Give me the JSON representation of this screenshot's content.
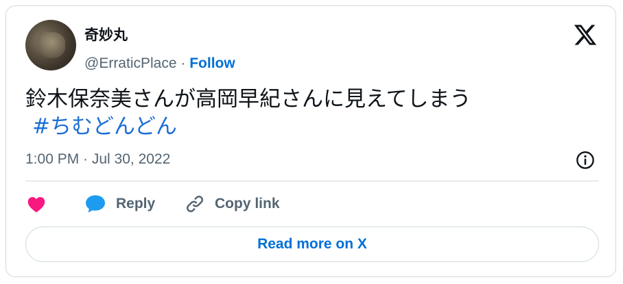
{
  "author": {
    "display_name": "奇妙丸",
    "handle": "@ErraticPlace",
    "separator": "·",
    "follow_label": "Follow"
  },
  "tweet": {
    "text": "鈴木保奈美さんが高岡早紀さんに見えてしまう",
    "hashtag": "#ちむどんどん",
    "timestamp": "1:00 PM · Jul 30, 2022"
  },
  "actions": {
    "reply_label": "Reply",
    "copy_link_label": "Copy link"
  },
  "read_more_label": "Read more on X",
  "colors": {
    "accent": "#006fd6",
    "like": "#f91880",
    "reply": "#1d9bf0",
    "muted": "#536471",
    "border": "#cfd9de"
  },
  "icons": [
    "x-logo-icon",
    "info-icon",
    "heart-icon",
    "speech-bubble-icon",
    "link-icon"
  ]
}
